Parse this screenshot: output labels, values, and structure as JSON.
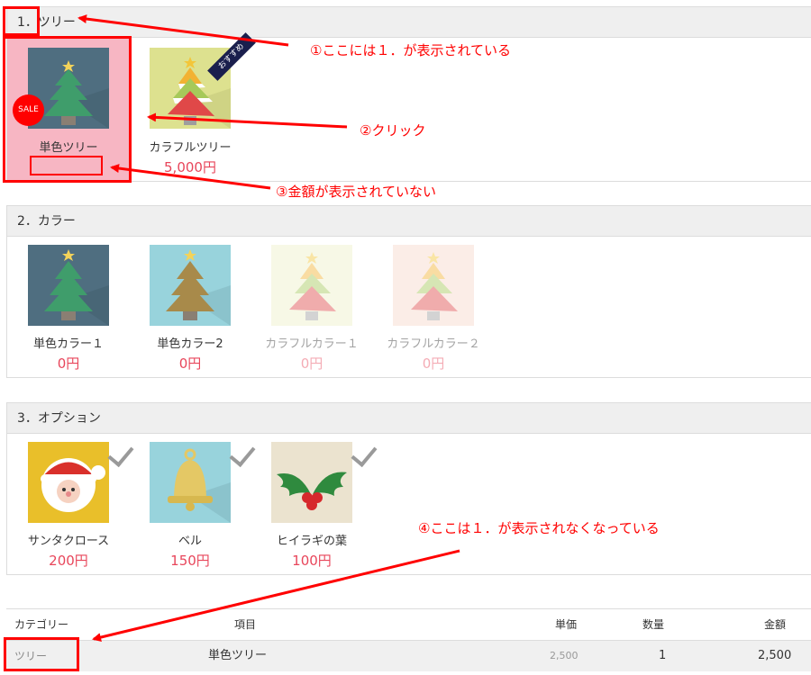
{
  "sections": [
    {
      "number": "1．",
      "title": "ツリー"
    },
    {
      "number": "2．",
      "title": "カラー"
    },
    {
      "number": "3．",
      "title": "オプション"
    }
  ],
  "tree_items": [
    {
      "name": "単色ツリー",
      "price": "",
      "badge": "SALE",
      "selected": true
    },
    {
      "name": "カラフルツリー",
      "price": "5,000円",
      "ribbon": "おすすめ",
      "selected": false
    }
  ],
  "color_items": [
    {
      "name": "単色カラー１",
      "price": "0円",
      "disabled": false
    },
    {
      "name": "単色カラー2",
      "price": "0円",
      "disabled": false
    },
    {
      "name": "カラフルカラー１",
      "price": "0円",
      "disabled": true
    },
    {
      "name": "カラフルカラー２",
      "price": "0円",
      "disabled": true
    }
  ],
  "option_items": [
    {
      "name": "サンタクロース",
      "price": "200円"
    },
    {
      "name": "ベル",
      "price": "150円"
    },
    {
      "name": "ヒイラギの葉",
      "price": "100円"
    }
  ],
  "annotations": {
    "note1": "①ここには１．が表示されている",
    "note2": "②クリック",
    "note3": "③金額が表示されていない",
    "note4": "④ここは１．が表示されなくなっている"
  },
  "table": {
    "headers": {
      "category": "カテゴリー",
      "item": "項目",
      "unit_price": "単価",
      "quantity": "数量",
      "amount": "金額"
    },
    "row": {
      "category": "ツリー",
      "item": "単色ツリー",
      "unit_price": "2,500",
      "quantity": "1",
      "amount": "2,500"
    }
  },
  "colors": {
    "annotation": "#ff0000",
    "price": "#e8465b",
    "selected_bg": "#f7b6c3"
  }
}
